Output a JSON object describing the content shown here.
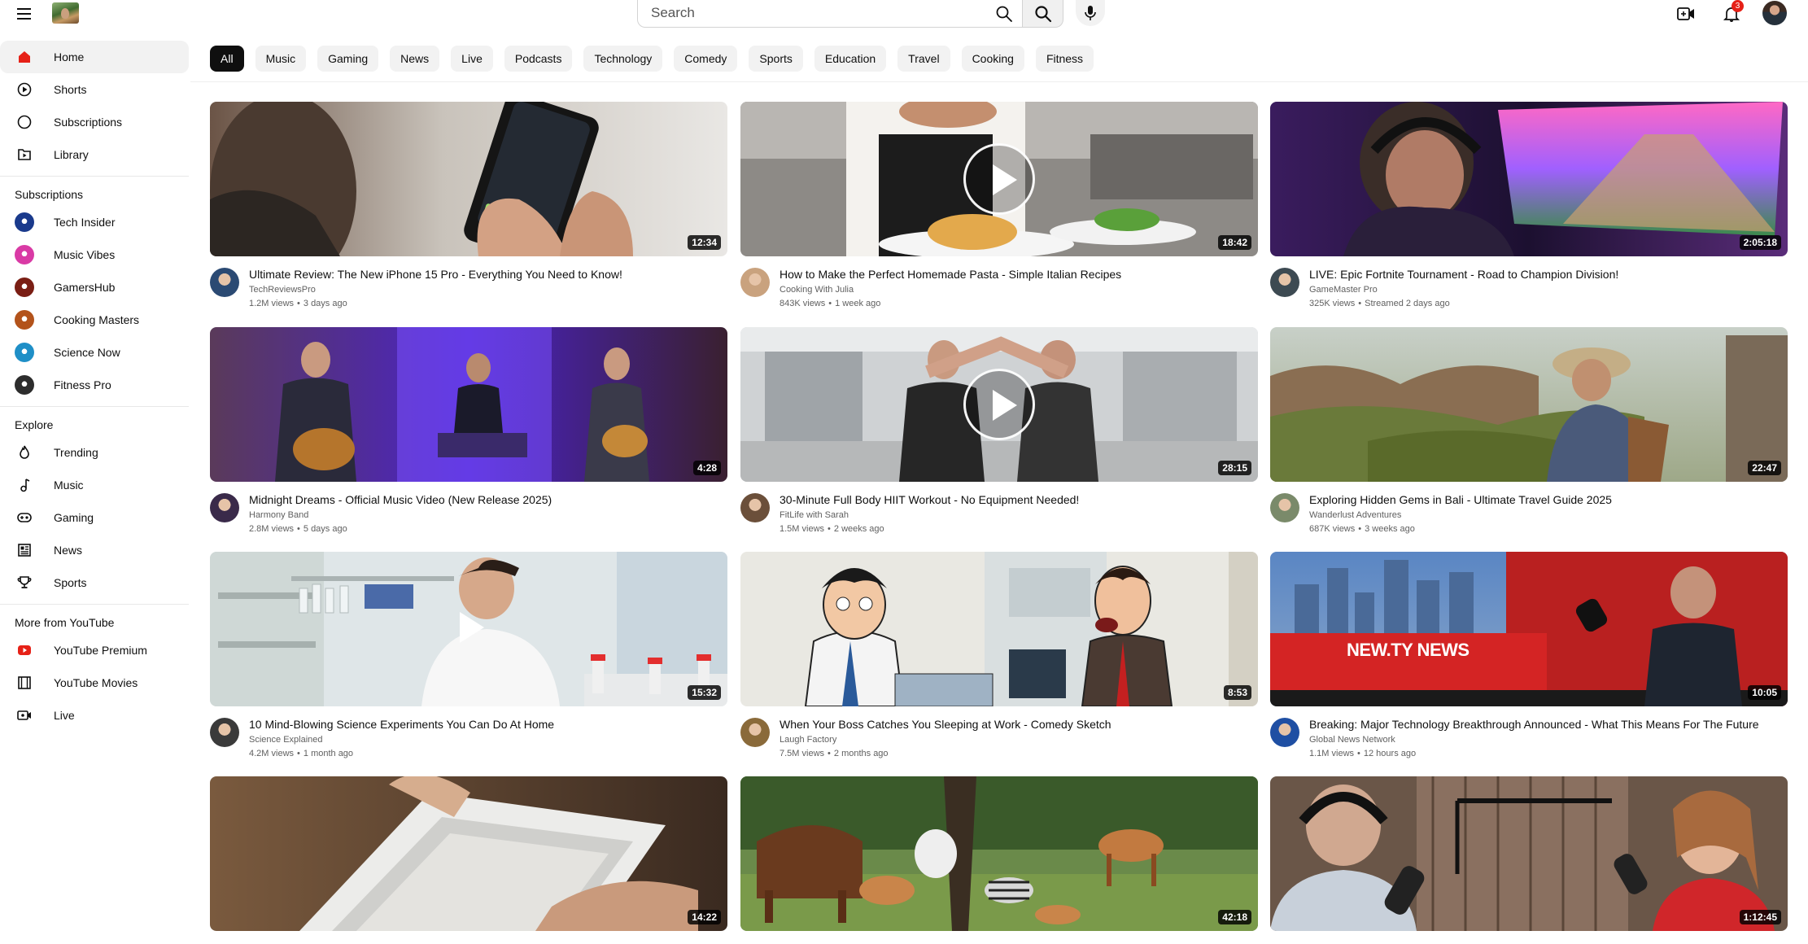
{
  "header": {
    "search_placeholder": "Search",
    "notification_count": "3"
  },
  "sidebar": {
    "main": [
      {
        "label": "Home",
        "icon": "home-icon",
        "active": true
      },
      {
        "label": "Shorts",
        "icon": "shorts-icon"
      },
      {
        "label": "Subscriptions",
        "icon": "subscriptions-icon"
      },
      {
        "label": "Library",
        "icon": "library-icon"
      }
    ],
    "subscriptions_heading": "Subscriptions",
    "subscriptions": [
      {
        "label": "Tech Insider",
        "color": "#1a3a8c"
      },
      {
        "label": "Music Vibes",
        "color": "#d93aa5"
      },
      {
        "label": "GamersHub",
        "color": "#7a1e14"
      },
      {
        "label": "Cooking Masters",
        "color": "#b3531b"
      },
      {
        "label": "Science Now",
        "color": "#1f8fc7"
      },
      {
        "label": "Fitness Pro",
        "color": "#2d2d2d"
      }
    ],
    "explore_heading": "Explore",
    "explore": [
      {
        "label": "Trending",
        "icon": "flame-icon"
      },
      {
        "label": "Music",
        "icon": "music-note-icon"
      },
      {
        "label": "Gaming",
        "icon": "gamepad-icon"
      },
      {
        "label": "News",
        "icon": "newspaper-icon"
      },
      {
        "label": "Sports",
        "icon": "trophy-icon"
      }
    ],
    "more_heading": "More from YouTube",
    "more": [
      {
        "label": "YouTube Premium",
        "icon": "youtube-premium-icon"
      },
      {
        "label": "YouTube Movies",
        "icon": "film-icon"
      },
      {
        "label": "Live",
        "icon": "live-icon"
      }
    ]
  },
  "chips": [
    "All",
    "Music",
    "Gaming",
    "News",
    "Live",
    "Podcasts",
    "Technology",
    "Comedy",
    "Sports",
    "Education",
    "Travel",
    "Cooking",
    "Fitness"
  ],
  "videos": [
    {
      "title": "Ultimate Review: The New iPhone 15 Pro - Everything You Need to Know!",
      "channel": "TechReviewsPro",
      "views": "1.2M views",
      "age": "3 days ago",
      "duration": "12:34",
      "scene": "phone",
      "avatar": "#2b4a73"
    },
    {
      "title": "How to Make the Perfect Homemade Pasta - Simple Italian Recipes",
      "channel": "Cooking With Julia",
      "views": "843K views",
      "age": "1 week ago",
      "duration": "18:42",
      "scene": "pasta",
      "avatar": "#c9a27e"
    },
    {
      "title": "LIVE: Epic Fortnite Tournament - Road to Champion Division!",
      "channel": "GameMaster Pro",
      "views": "325K views",
      "age": "Streamed 2 days ago",
      "duration": "2:05:18",
      "scene": "gaming",
      "avatar": "#3d4a52"
    },
    {
      "title": "Midnight Dreams - Official Music Video (New Release 2025)",
      "channel": "Harmony Band",
      "views": "2.8M views",
      "age": "5 days ago",
      "duration": "4:28",
      "scene": "band",
      "avatar": "#3a2a4a"
    },
    {
      "title": "30-Minute Full Body HIIT Workout - No Equipment Needed!",
      "channel": "FitLife with Sarah",
      "views": "1.5M views",
      "age": "2 weeks ago",
      "duration": "28:15",
      "scene": "gym",
      "avatar": "#6b4f3a"
    },
    {
      "title": "Exploring Hidden Gems in Bali - Ultimate Travel Guide 2025",
      "channel": "Wanderlust Adventures",
      "views": "687K views",
      "age": "3 weeks ago",
      "duration": "22:47",
      "scene": "travel",
      "avatar": "#7a8a6a"
    },
    {
      "title": "10 Mind-Blowing Science Experiments You Can Do At Home",
      "channel": "Science Explained",
      "views": "4.2M views",
      "age": "1 month ago",
      "duration": "15:32",
      "scene": "lab",
      "avatar": "#3a3a3a"
    },
    {
      "title": "When Your Boss Catches You Sleeping at Work - Comedy Sketch",
      "channel": "Laugh Factory",
      "views": "7.5M views",
      "age": "2 months ago",
      "duration": "8:53",
      "scene": "cartoon",
      "avatar": "#8a6a3a"
    },
    {
      "title": "Breaking: Major Technology Breakthrough Announced - What This Means For The Future",
      "channel": "Global News Network",
      "views": "1.1M views",
      "age": "12 hours ago",
      "duration": "10:05",
      "scene": "news",
      "avatar": "#1f4fa3",
      "news_label": "NEW.TY NEWS"
    },
    {
      "title": "",
      "channel": "",
      "views": "",
      "age": "",
      "duration": "14:22",
      "scene": "unbox",
      "avatar": "#888888"
    },
    {
      "title": "",
      "channel": "",
      "views": "",
      "age": "",
      "duration": "42:18",
      "scene": "wildlife",
      "avatar": "#888888"
    },
    {
      "title": "",
      "channel": "",
      "views": "",
      "age": "",
      "duration": "1:12:45",
      "scene": "podcast",
      "avatar": "#888888"
    }
  ]
}
